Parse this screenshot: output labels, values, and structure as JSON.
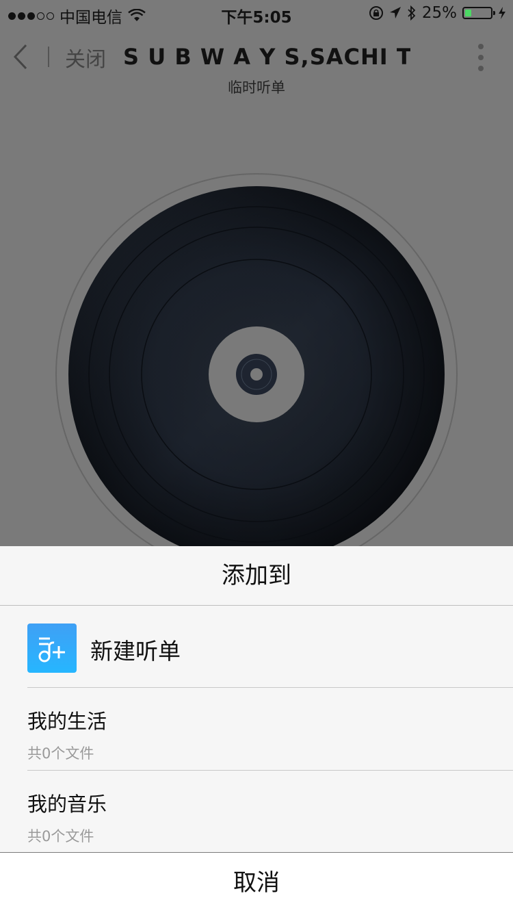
{
  "status_bar": {
    "carrier": "中国电信",
    "time": "下午5:05",
    "battery": "25%",
    "battery_level": 0.25
  },
  "nav": {
    "close_label": "关闭",
    "title": "S U B W A Y S,SACHI T...",
    "subtitle": "临时听单"
  },
  "sheet": {
    "title": "添加到",
    "new_label": "新建听单",
    "playlists": [
      {
        "name": "我的生活",
        "count": "共0个文件"
      },
      {
        "name": "我的音乐",
        "count": "共0个文件"
      }
    ],
    "cancel_label": "取消"
  },
  "colors": {
    "accent": "#26b6ff",
    "battery": "#4cd964",
    "overlay": "#7a7a7a"
  },
  "icons": [
    "back-chevron-icon",
    "more-vertical-icon",
    "wifi-icon",
    "rotation-lock-icon",
    "location-icon",
    "bluetooth-icon",
    "charging-icon",
    "new-playlist-icon"
  ]
}
